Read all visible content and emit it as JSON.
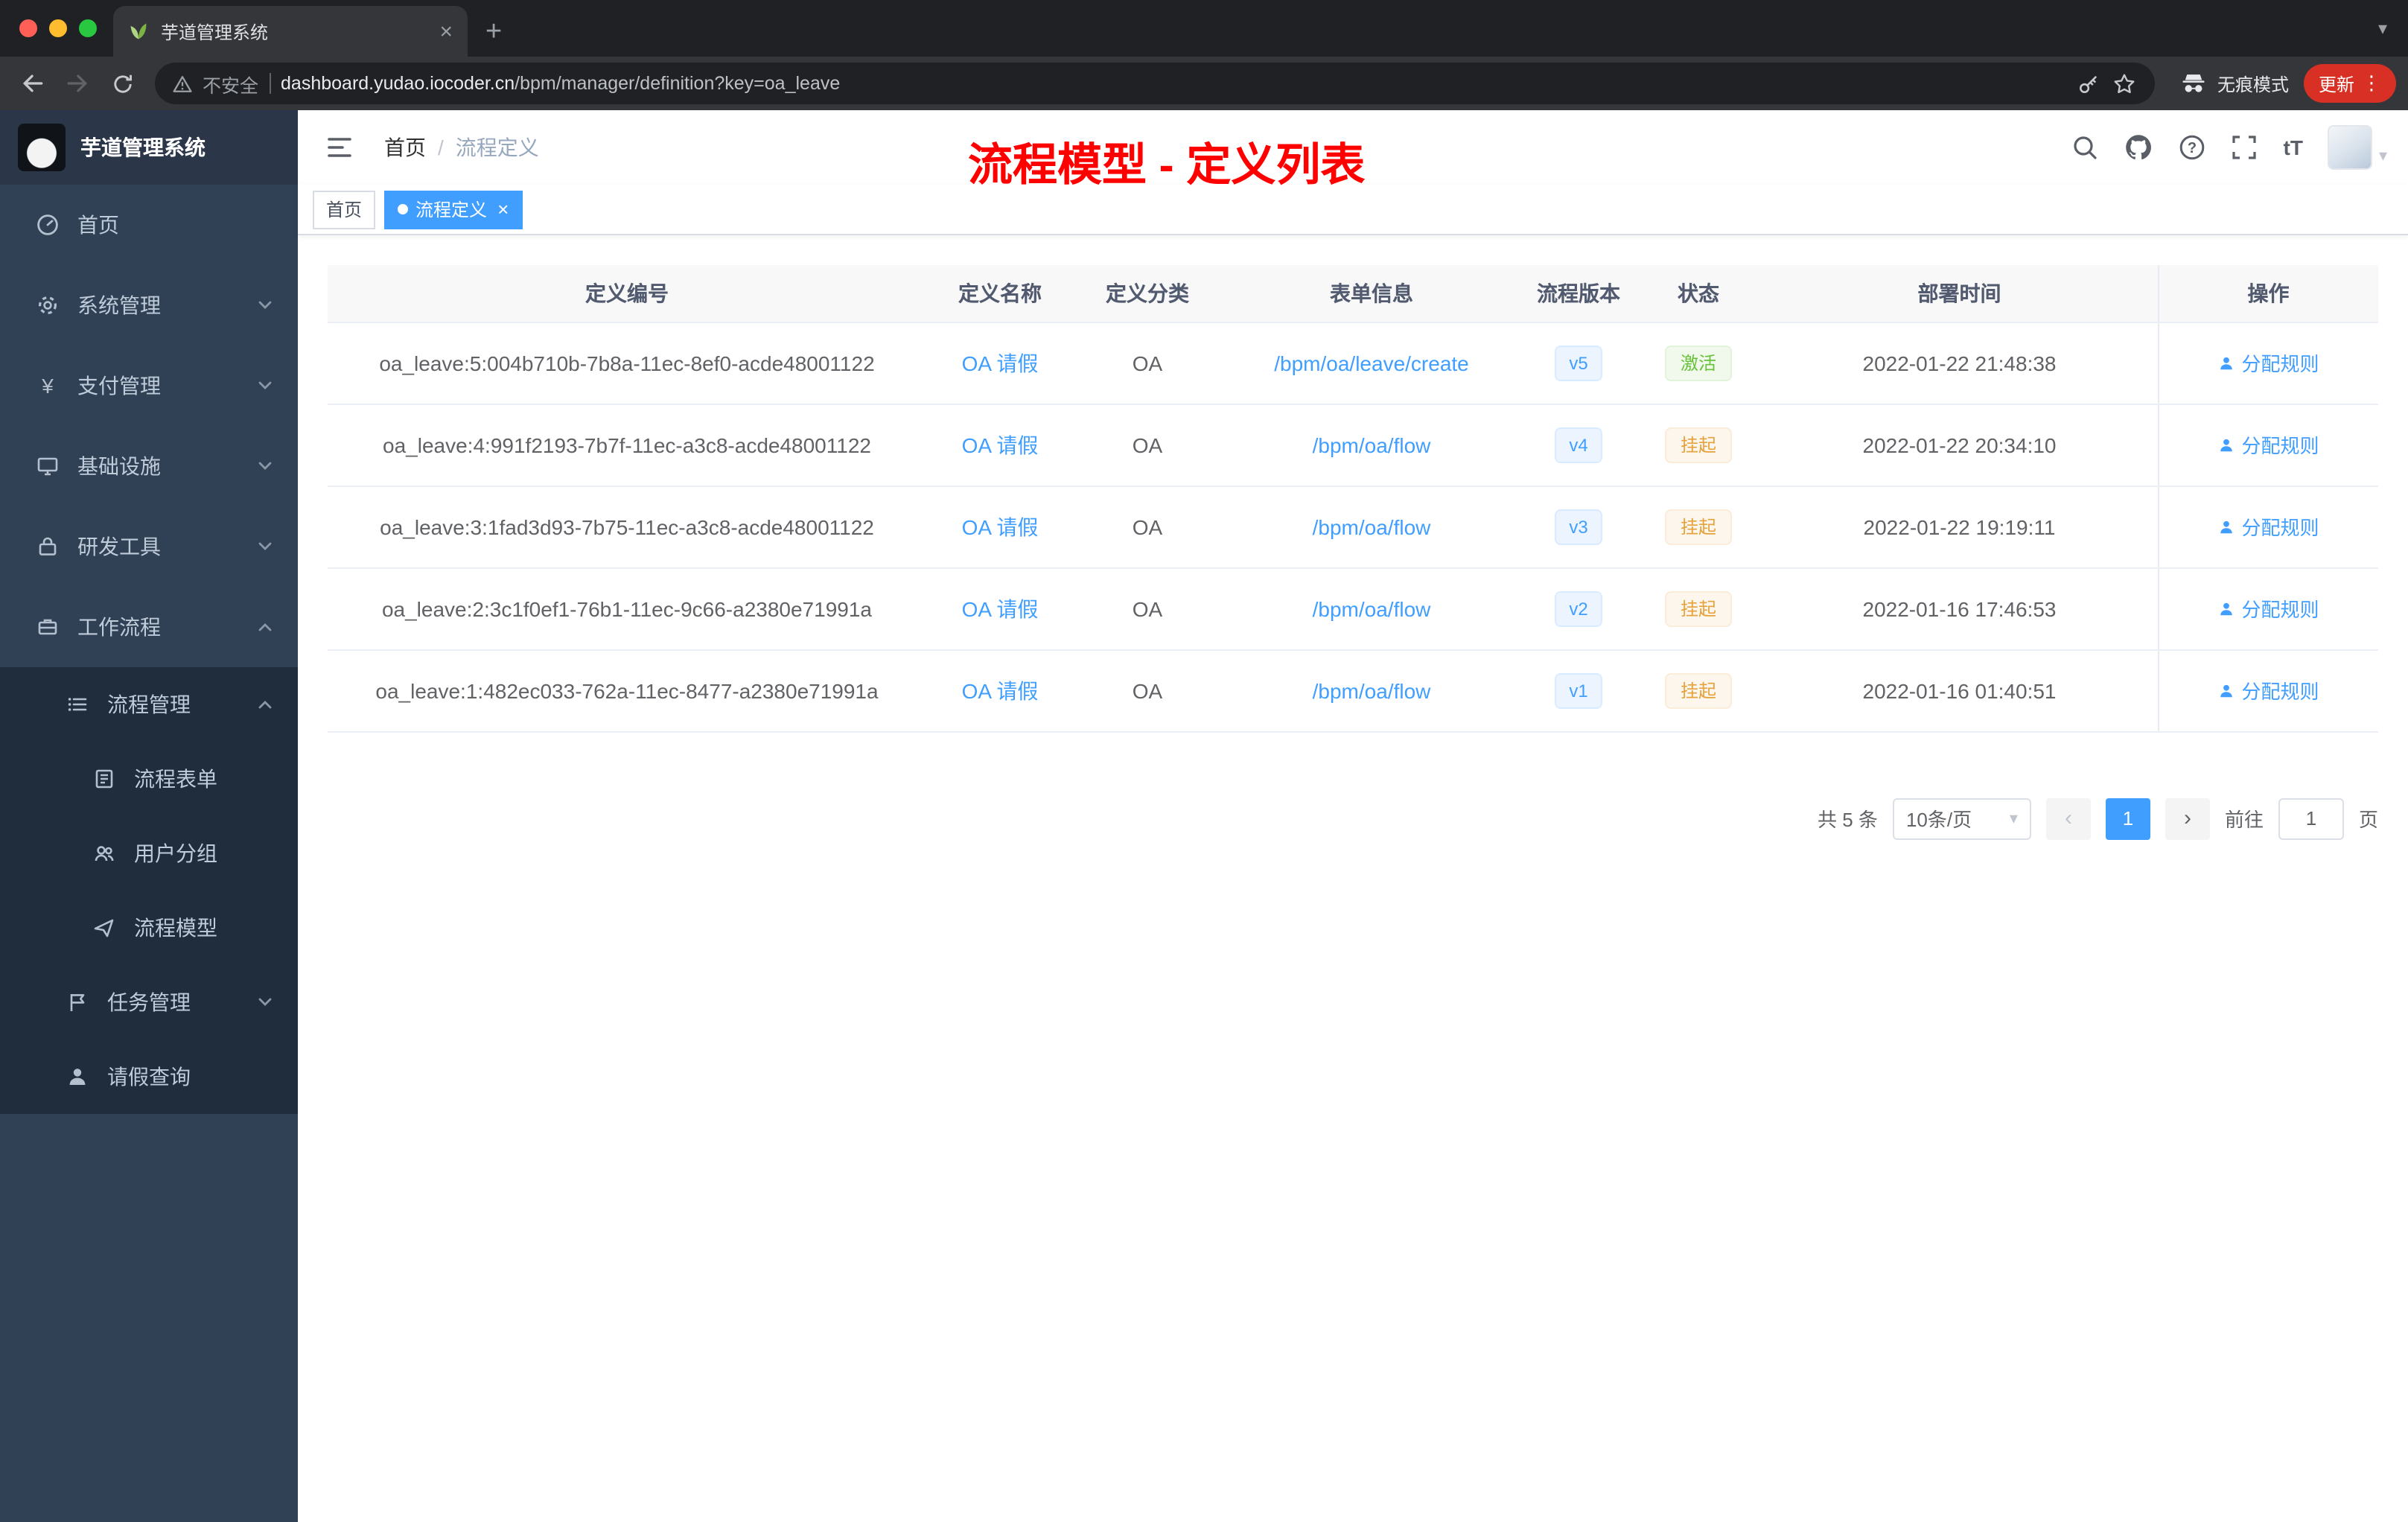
{
  "icons": {
    "close": "×",
    "plus": "+",
    "yen": "¥",
    "caret_down": "▾",
    "breadcrumb_sep": "/",
    "font_size": "tT",
    "prev": "‹",
    "next": "›",
    "more_vertical": "⋮",
    "question": "?"
  },
  "browser": {
    "tab_title": "芋道管理系统",
    "security_label": "不安全",
    "url_host": "dashboard.yudao.iocoder.cn",
    "url_path": "/bpm/manager/definition?key=oa_leave",
    "incognito_label": "无痕模式",
    "update_label": "更新"
  },
  "sidebar": {
    "logo_title": "芋道管理系统",
    "items": [
      {
        "label": "首页"
      },
      {
        "label": "系统管理"
      },
      {
        "label": "支付管理"
      },
      {
        "label": "基础设施"
      },
      {
        "label": "研发工具"
      },
      {
        "label": "工作流程"
      },
      {
        "label": "流程管理"
      },
      {
        "label": "流程表单"
      },
      {
        "label": "用户分组"
      },
      {
        "label": "流程模型"
      },
      {
        "label": "任务管理"
      },
      {
        "label": "请假查询"
      }
    ]
  },
  "header": {
    "breadcrumb_home": "首页",
    "breadcrumb_current": "流程定义",
    "annotation": "流程模型 - 定义列表"
  },
  "tags": {
    "home": "首页",
    "active": "流程定义"
  },
  "table": {
    "columns": [
      "定义编号",
      "定义名称",
      "定义分类",
      "表单信息",
      "流程版本",
      "状态",
      "部署时间",
      "操作"
    ],
    "rows": [
      {
        "id": "oa_leave:5:004b710b-7b8a-11ec-8ef0-acde48001122",
        "name": "OA 请假",
        "category": "OA",
        "form": "/bpm/oa/leave/create",
        "version": "v5",
        "status": "激活",
        "status_type": "success",
        "time": "2022-01-22 21:48:38",
        "action": "分配规则"
      },
      {
        "id": "oa_leave:4:991f2193-7b7f-11ec-a3c8-acde48001122",
        "name": "OA 请假",
        "category": "OA",
        "form": "/bpm/oa/flow",
        "version": "v4",
        "status": "挂起",
        "status_type": "warning",
        "time": "2022-01-22 20:34:10",
        "action": "分配规则"
      },
      {
        "id": "oa_leave:3:1fad3d93-7b75-11ec-a3c8-acde48001122",
        "name": "OA 请假",
        "category": "OA",
        "form": "/bpm/oa/flow",
        "version": "v3",
        "status": "挂起",
        "status_type": "warning",
        "time": "2022-01-22 19:19:11",
        "action": "分配规则"
      },
      {
        "id": "oa_leave:2:3c1f0ef1-76b1-11ec-9c66-a2380e71991a",
        "name": "OA 请假",
        "category": "OA",
        "form": "/bpm/oa/flow",
        "version": "v2",
        "status": "挂起",
        "status_type": "warning",
        "time": "2022-01-16 17:46:53",
        "action": "分配规则"
      },
      {
        "id": "oa_leave:1:482ec033-762a-11ec-8477-a2380e71991a",
        "name": "OA 请假",
        "category": "OA",
        "form": "/bpm/oa/flow",
        "version": "v1",
        "status": "挂起",
        "status_type": "warning",
        "time": "2022-01-16 01:40:51",
        "action": "分配规则"
      }
    ]
  },
  "pagination": {
    "total": "共 5 条",
    "page_size": "10条/页",
    "page": "1",
    "goto": "前往",
    "goto_value": "1",
    "page_unit": "页"
  }
}
